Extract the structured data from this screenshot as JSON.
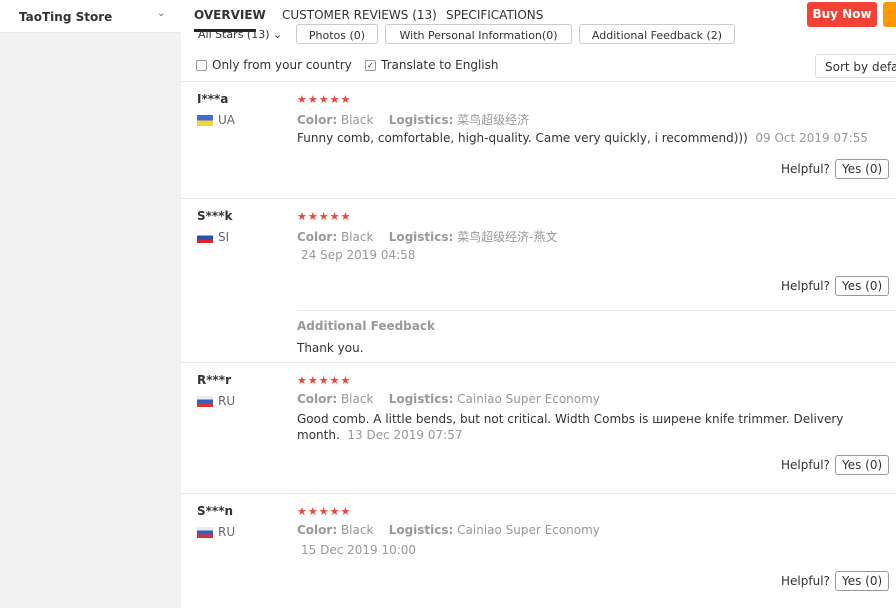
{
  "store": {
    "name": "TaoTing Store",
    "chevron_icon": "chevron-down-icon"
  },
  "tabs": [
    {
      "label": "OVERVIEW",
      "active": true
    },
    {
      "label": "CUSTOMER REVIEWS (13)",
      "active": false
    },
    {
      "label": "SPECIFICATIONS",
      "active": false
    }
  ],
  "actions": {
    "buy_now": "Buy Now"
  },
  "filters": {
    "all_stars": "All Stars (13)",
    "photos": "Photos (0)",
    "personal_info": "With Personal Information(0)",
    "additional_feedback": "Additional Feedback (2)"
  },
  "options": {
    "only_country": "Only from your country",
    "only_country_checked": false,
    "translate": "Translate to English",
    "translate_checked": true,
    "sort": "Sort by default"
  },
  "colors": {
    "accent": "#f44336",
    "orange": "#ff9800"
  },
  "reviews": [
    {
      "user": "I***a",
      "country": "UA",
      "flag": "flag-ua",
      "stars": "★★★★★",
      "color_label": "Color:",
      "color": "Black",
      "logistics_label": "Logistics:",
      "logistics": "菜鸟超级经济",
      "text": "Funny comb, comfortable, high-quality. Came very quickly, i recommend)))",
      "date": "09 Oct 2019 07:55",
      "helpful": "Helpful?",
      "yes": "Yes (0)"
    },
    {
      "user": "S***k",
      "country": "SI",
      "flag": "flag-si",
      "stars": "★★★★★",
      "color_label": "Color:",
      "color": "Black",
      "logistics_label": "Logistics:",
      "logistics": "菜鸟超级经济-燕文",
      "text": "",
      "date": "24 Sep 2019 04:58",
      "helpful": "Helpful?",
      "yes": "Yes (0)",
      "additional_label": "Additional Feedback",
      "additional_text": "Thank you."
    },
    {
      "user": "R***r",
      "country": "RU",
      "flag": "flag-ru",
      "stars": "★★★★★",
      "color_label": "Color:",
      "color": "Black",
      "logistics_label": "Logistics:",
      "logistics": "Cainiao Super Economy",
      "text": "Good comb. A little bends, but not critical. Width Combs is ширене knife trimmer. Delivery month.",
      "date": "13 Dec 2019 07:57",
      "helpful": "Helpful?",
      "yes": "Yes (0)"
    },
    {
      "user": "S***n",
      "country": "RU",
      "flag": "flag-ru",
      "stars": "★★★★★",
      "color_label": "Color:",
      "color": "Black",
      "logistics_label": "Logistics:",
      "logistics": "Cainiao Super Economy",
      "text": "",
      "date": "15 Dec 2019 10:00",
      "helpful": "Helpful?",
      "yes": "Yes (0)"
    }
  ]
}
